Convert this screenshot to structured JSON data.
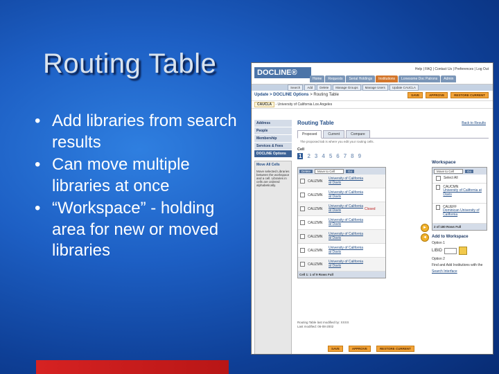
{
  "slide": {
    "title": "Routing Table",
    "bullets": [
      "Add libraries from search results",
      "Can move multiple libraries at once",
      "“Workspace” - holding area for new or moved libraries"
    ],
    "colors": {
      "background": "#1d5fc4",
      "title_text": "#d9e3ee",
      "accent_bar": "#d62222"
    }
  },
  "screenshot": {
    "logo": "DOCLINE®",
    "top_links": "Help | FAQ | Contact Us | Preferences | Log Out",
    "nav_tabs": [
      "Home",
      "Requests",
      "Serial Holdings",
      "Institutions",
      "Lonesome Doc Patrons",
      "Admin"
    ],
    "active_nav_tab": "Institutions",
    "sub_nav": [
      "Search",
      "Add",
      "Delete",
      "Manage Groups",
      "Manage Users",
      "Update CAUCLA"
    ],
    "breadcrumb": {
      "section": "Update",
      "path": "> DOCLINE Options",
      "current": "> Routing Table"
    },
    "buttons": {
      "save": "SAVE",
      "approve": "APPROVE",
      "restore": "RESTORE CURRENT"
    },
    "institution": {
      "code": "CAUCLA",
      "name": "- University of California Los Angeles"
    },
    "sidebar": {
      "items": [
        "Address",
        "People",
        "Membership",
        "Services & Fees",
        "DOCLINE Options"
      ],
      "move_all": "Move All Cells",
      "help_text": "Move selected Libraries between the workspace and a cell. Libraries in cells are ordered alphabetically."
    },
    "routing": {
      "title": "Routing Table",
      "back_link": "Back to Results",
      "tabs": [
        "Proposed",
        "Current",
        "Compare"
      ],
      "tab_note": "The proposed tab is where you edit your routing cells.",
      "cell_label": "Cell",
      "cell_numbers": [
        "1",
        "2",
        "3",
        "4",
        "5",
        "6",
        "7",
        "8",
        "9"
      ],
      "delete_label": "Delete",
      "move_to_label": "Move to Cell",
      "go_label": "Go",
      "rows": [
        {
          "code": "CAUZMN",
          "name": "University of California at Davis",
          "status": ""
        },
        {
          "code": "CAUZMN",
          "name": "University of California at Davis",
          "status": ""
        },
        {
          "code": "CAUZMN",
          "name": "University of California at Davis",
          "status": "Closed"
        },
        {
          "code": "CAUZMN",
          "name": "University of California at Davis",
          "status": ""
        },
        {
          "code": "CAUZMN",
          "name": "University of California at Davis",
          "status": ""
        },
        {
          "code": "CAUZMN",
          "name": "University of California at Davis",
          "status": ""
        },
        {
          "code": "CAUZMN",
          "name": "University of California at Davis",
          "status": ""
        }
      ],
      "cell_footer": "Cell 1: 1 of 9 Rows Full"
    },
    "workspace": {
      "title": "Workspace",
      "move_to_label": "Move to Cell",
      "go_label": "Go",
      "select_all": "Select All",
      "items": [
        {
          "code": "CAUCMN",
          "name": "University of California at Davis"
        },
        {
          "code": "CAUEFF",
          "name": "Dominican University of California"
        }
      ],
      "footer": "2 of 180 Rows Full",
      "add_title": "Add to Workspace",
      "option1": "Option 1",
      "libid_label": "LIBID",
      "option2": "Option 2",
      "option2_text": "Find and Add Institutions with the",
      "search_link": "Search Interface"
    },
    "footnote_lines": [
      "Routing Table last modified by: XXXX",
      "Last modified: 06-08-2002"
    ]
  }
}
